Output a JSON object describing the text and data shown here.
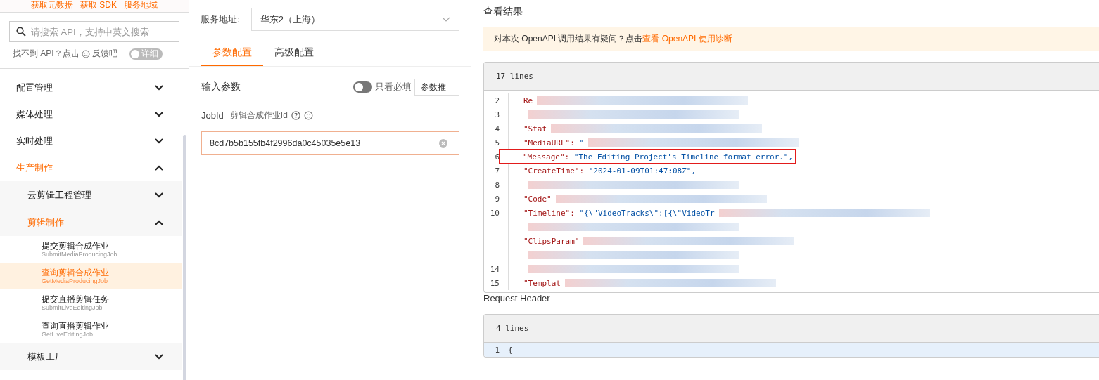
{
  "top_links": [
    "获取元数据",
    "获取 SDK",
    "服务地域"
  ],
  "search": {
    "placeholder": "请搜索 API，支持中英文搜索"
  },
  "feedback": {
    "text": "找不到 API？点击",
    "link": "反馈吧",
    "toggle_label": "详细",
    "toggle_on": false
  },
  "nav": [
    {
      "label": "配置管理",
      "expanded": false
    },
    {
      "label": "媒体处理",
      "expanded": false
    },
    {
      "label": "实时处理",
      "expanded": false
    },
    {
      "label": "生产制作",
      "expanded": true,
      "children": [
        {
          "label": "云剪辑工程管理",
          "expanded": false
        },
        {
          "label": "剪辑制作",
          "expanded": true,
          "children": [
            {
              "label": "提交剪辑合成作业",
              "sublabel": "SubmitMediaProducingJob",
              "selected": false
            },
            {
              "label": "查询剪辑合成作业",
              "sublabel": "GetMediaProducingJob",
              "selected": true
            },
            {
              "label": "提交直播剪辑任务",
              "sublabel": "SubmitLiveEditingJob",
              "selected": false
            },
            {
              "label": "查询直播剪辑作业",
              "sublabel": "GetLiveEditingJob",
              "selected": false
            }
          ]
        },
        {
          "label": "模板工厂",
          "expanded": false
        }
      ]
    }
  ],
  "service": {
    "label": "服务地址:",
    "value": "华东2（上海）"
  },
  "tabs": [
    {
      "label": "参数配置",
      "selected": true
    },
    {
      "label": "高级配置",
      "selected": false
    }
  ],
  "params": {
    "title": "输入参数",
    "required_only_label": "只看必填",
    "required_only": false,
    "recommend_button": "参数推"
  },
  "field": {
    "name": "JobId",
    "description": "剪辑合成作业Id",
    "value": "8cd7b5b155fb4f2996da0c45035e5e13"
  },
  "result": {
    "title": "查看结果",
    "notice": "对本次 OpenAPI 调用结果有疑问？点击",
    "notice_link": "查看 OpenAPI 使用诊断",
    "lines_label": "17 lines",
    "lines": [
      {
        "number": "2",
        "key": "Re",
        "redacted": true,
        "boxed": false
      },
      {
        "number": "3",
        "redacted": true,
        "boxed": false
      },
      {
        "number": "4",
        "key": "\"Stat",
        "redacted": true,
        "boxed": false
      },
      {
        "number": "5",
        "key": "\"MediaURL\": ",
        "value": "\"",
        "redacted": true,
        "boxed": false
      },
      {
        "number": "6",
        "key": "\"Message\": ",
        "value": "\"The Editing Project's Timeline format error.\",",
        "redacted": false,
        "boxed": true
      },
      {
        "number": "7",
        "key": "\"CreateTime\": ",
        "value": "\"2024-01-09T01:47:08Z\",",
        "redacted": false,
        "boxed": false
      },
      {
        "number": "8",
        "redacted": true,
        "boxed": false
      },
      {
        "number": "9",
        "key": "\"Code\"",
        "redacted": true,
        "boxed": false
      },
      {
        "number": "10",
        "key": "\"Timeline\": ",
        "value": "\"{\\\"VideoTracks\\\":[{\\\"VideoTr",
        "redacted": true,
        "boxed": false
      },
      {
        "redacted": true,
        "boxed": false
      },
      {
        "key": "\"ClipsParam\"",
        "redacted": true,
        "boxed": false
      },
      {
        "redacted": true,
        "boxed": false
      },
      {
        "number": "14",
        "redacted": true,
        "boxed": false
      },
      {
        "number": "15",
        "key": "\"Templat",
        "redacted": true,
        "boxed": false
      }
    ]
  },
  "header": {
    "title": "Request Header",
    "lines_label": "4 lines",
    "lines": [
      {
        "number": "1",
        "value": "{"
      }
    ]
  }
}
